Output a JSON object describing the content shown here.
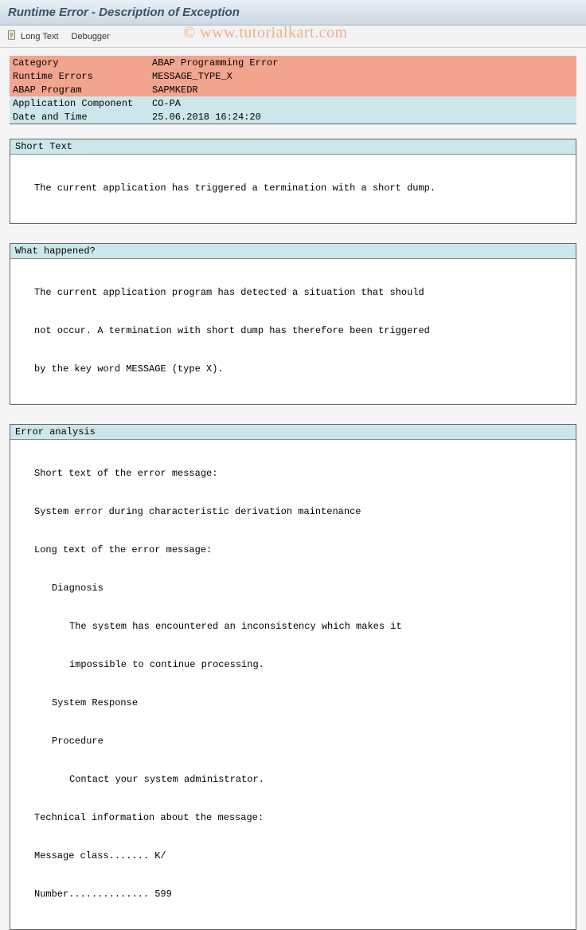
{
  "title": "Runtime Error - Description of Exception",
  "toolbar": {
    "long_text": "Long Text",
    "debugger": "Debugger"
  },
  "meta": {
    "category_label": "Category",
    "category_value": "ABAP Programming Error",
    "runtime_errors_label": "Runtime Errors",
    "runtime_errors_value": "MESSAGE_TYPE_X",
    "abap_program_label": "ABAP Program",
    "abap_program_value": "SAPMKEDR",
    "app_component_label": "Application Component",
    "app_component_value": "CO-PA",
    "datetime_label": "Date and Time",
    "datetime_value": "25.06.2018 16:24:20"
  },
  "short_text": {
    "header": "Short Text",
    "line1": "The current application has triggered a termination with a short dump."
  },
  "what_happened": {
    "header": "What happened?",
    "line1": "The current application program has detected a situation that should",
    "line2": "not occur. A termination with short dump has therefore been triggered",
    "line3": "by the key word MESSAGE (type X)."
  },
  "error_analysis": {
    "header": "Error analysis",
    "l1": "Short text of the error message:",
    "l2": "System error during characteristic derivation maintenance",
    "l3": "Long text of the error message:",
    "l4": "Diagnosis",
    "l5": "The system has encountered an inconsistency which makes it",
    "l6": "impossible to continue processing.",
    "l7": "System Response",
    "l8": "Procedure",
    "l9": "Contact your system administrator.",
    "l10": "Technical information about the message:",
    "l11": "Message class....... K/",
    "l12": "Number.............. 599"
  },
  "watermark": "© www.tutorialkart.com"
}
